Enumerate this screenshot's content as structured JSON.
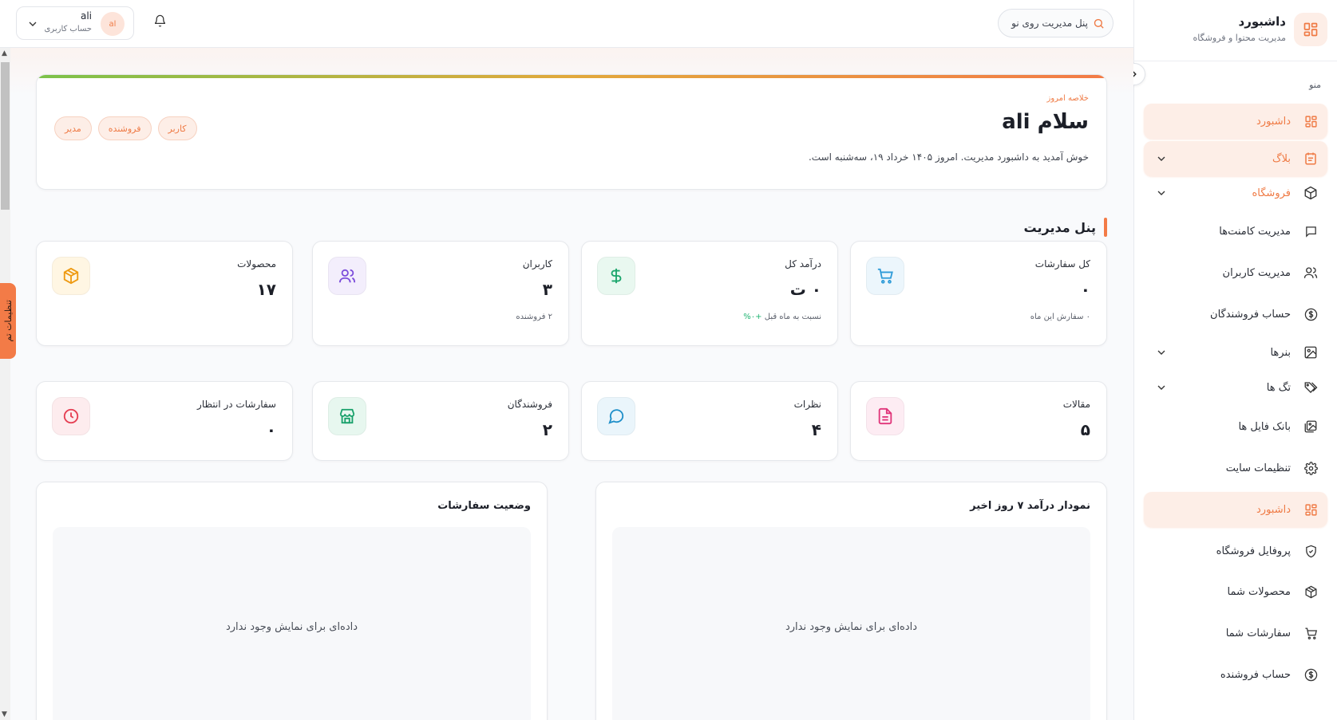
{
  "sidebar": {
    "brand_title": "داشبورد",
    "brand_subtitle": "مدیریت محتوا و فروشگاه",
    "menu_caption": "منو",
    "items": [
      {
        "label": "داشبورد",
        "icon": "grid-icon"
      },
      {
        "label": "بلاگ",
        "icon": "calendar-icon"
      },
      {
        "label": "فروشگاه",
        "icon": "package-icon"
      },
      {
        "label": "مدیریت کامنت‌ها",
        "icon": "message-square-icon"
      },
      {
        "label": "مدیریت کاربران",
        "icon": "users-icon"
      },
      {
        "label": "حساب فروشندگان",
        "icon": "dollar-circle-icon"
      },
      {
        "label": "بنرها",
        "icon": "image-icon"
      },
      {
        "label": "تگ ها",
        "icon": "tags-icon"
      },
      {
        "label": "بانک فایل ها",
        "icon": "images-icon"
      },
      {
        "label": "تنظیمات سایت",
        "icon": "gear-icon"
      },
      {
        "label": "داشبورد",
        "icon": "grid-icon"
      },
      {
        "label": "پروفایل فروشگاه",
        "icon": "shield-icon"
      },
      {
        "label": "محصولات شما",
        "icon": "packages-icon"
      },
      {
        "label": "سفارشات شما",
        "icon": "cart-icon"
      },
      {
        "label": "حساب فروشنده",
        "icon": "dollar-circle-icon"
      }
    ]
  },
  "topbar": {
    "search_placeholder": "پنل مدیریت روی نو",
    "account_name": "ali",
    "account_initials": "al",
    "account_role": "حساب کاربری"
  },
  "theme_tab": "تنظیمات تم",
  "welcome": {
    "caption": "خلاصه امروز",
    "title": "سلام ali",
    "text": "خوش آمدید به داشبورد مدیریت. امروز ۱۴۰۵ خرداد ۱۹، سه‌شنبه است.",
    "chips": [
      "کاربر",
      "فروشنده",
      "مدیر"
    ]
  },
  "section_title": "پنل مدیریت",
  "stats_row1": [
    {
      "label": "کل سفارشات",
      "value": "۰",
      "sub": "۰ سفارش این ماه",
      "icon": "cart-icon",
      "color": "#2f9bd8",
      "bg": "#ecf6fc"
    },
    {
      "label": "درآمد کل",
      "value": "۰ ت",
      "trend": "+۰%",
      "sub": "نسبت به ماه قبل",
      "icon": "dollar-icon",
      "color": "#1aa56b",
      "bg": "#e9f8f0"
    },
    {
      "label": "کاربران",
      "value": "۳",
      "sub": "۲ فروشنده",
      "icon": "users-icon",
      "color": "#7c4ddb",
      "bg": "#f3eefc"
    },
    {
      "label": "محصولات",
      "value": "۱۷",
      "sub": "",
      "icon": "package-icon",
      "color": "#ee9a12",
      "bg": "#fff6e3"
    }
  ],
  "stats_row2": [
    {
      "label": "مقالات",
      "value": "۵",
      "icon": "file-text-icon",
      "color": "#e0357a",
      "bg": "#fdecf3"
    },
    {
      "label": "نظرات",
      "value": "۴",
      "icon": "message-circle-icon",
      "color": "#1f8fc9",
      "bg": "#eaf5fb"
    },
    {
      "label": "فروشندگان",
      "value": "۲",
      "icon": "store-icon",
      "color": "#17a06a",
      "bg": "#e7f7ef"
    },
    {
      "label": "سفارشات در انتظار",
      "value": "۰",
      "icon": "clock-icon",
      "color": "#e53e52",
      "bg": "#fdecee"
    }
  ],
  "panels": [
    {
      "title": "نمودار درآمد ۷ روز اخیر",
      "empty": "داده‌ای برای نمایش وجود ندارد"
    },
    {
      "title": "وضعیت سفارشات",
      "empty": "داده‌ای برای نمایش وجود ندارد"
    }
  ],
  "colors": {
    "accent": "#f37b47"
  }
}
